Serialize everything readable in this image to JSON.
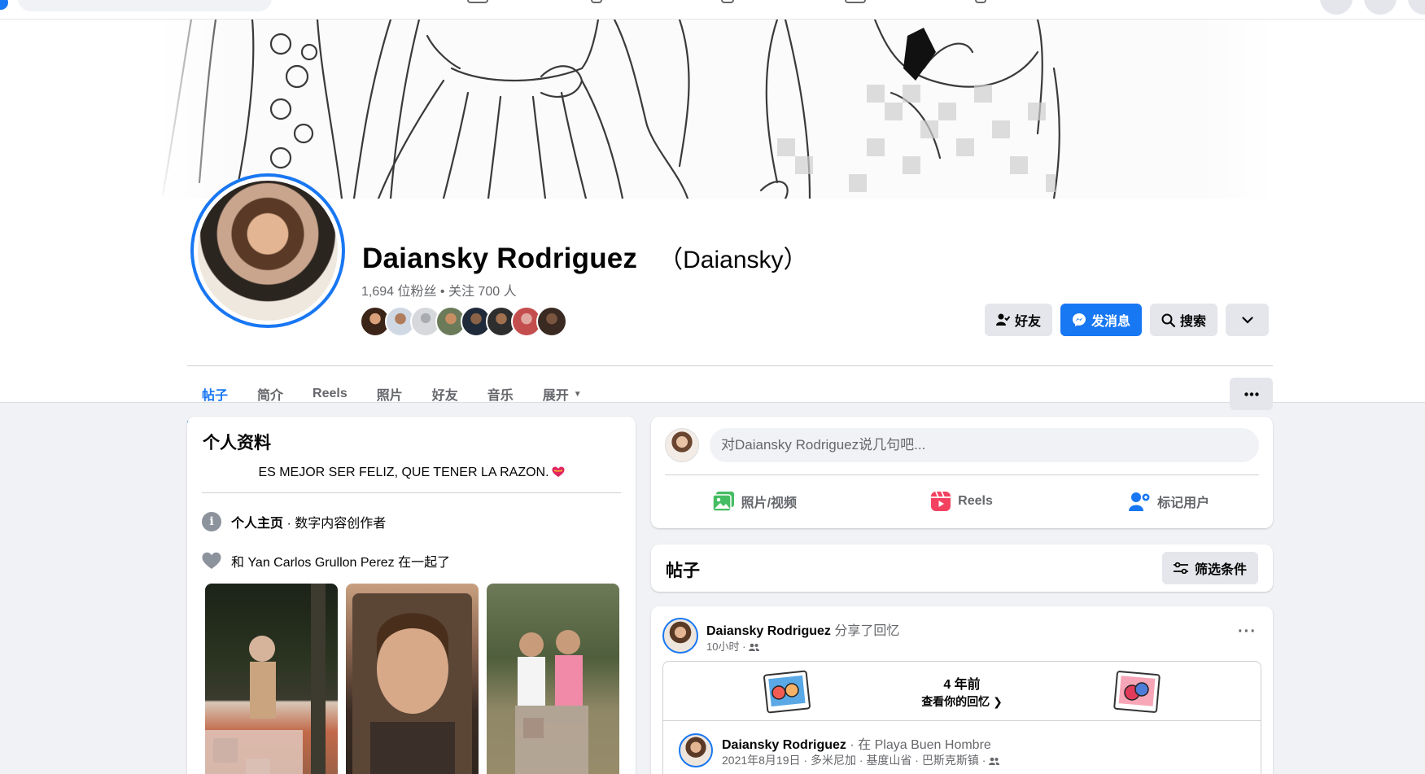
{
  "profile": {
    "name": "Daiansky Rodriguez",
    "alt_name": "（Daiansky）",
    "stats": "1,694 位粉丝 • 关注 700 人"
  },
  "actions": {
    "friends": "好友",
    "message": "发消息",
    "search": "搜索"
  },
  "tabs": [
    "帖子",
    "简介",
    "Reels",
    "照片",
    "好友",
    "音乐",
    "展开"
  ],
  "intro": {
    "title": "个人资料",
    "bio": "ES MEJOR SER FELIZ, QUE TENER LA RAZON.",
    "page_label": "个人主页",
    "page_category": " · 数字内容创作者",
    "relationship": "和 Yan Carlos Grullon Perez 在一起了"
  },
  "composer": {
    "placeholder": "对Daiansky Rodriguez说几句吧...",
    "photo_video": "照片/视频",
    "reels": "Reels",
    "tag_people": "标记用户"
  },
  "posts": {
    "title": "帖子",
    "filter": "筛选条件"
  },
  "post": {
    "author": "Daiansky Rodriguez",
    "action": " 分享了回忆",
    "time": "10小时 · ",
    "memory_title": "4 年前",
    "memory_link": "查看你的回忆",
    "inner_author": "Daiansky Rodriguez",
    "inner_location": " · 在 Playa Buen Hombre",
    "inner_meta": "2021年8月19日 · 多米尼加 · 基度山省 · 巴斯克斯镇 · "
  },
  "colors": {
    "accent": "#1877f2",
    "page_bg": "#f0f2f5",
    "button_gray": "#e4e6eb",
    "text_secondary": "#65676b"
  }
}
